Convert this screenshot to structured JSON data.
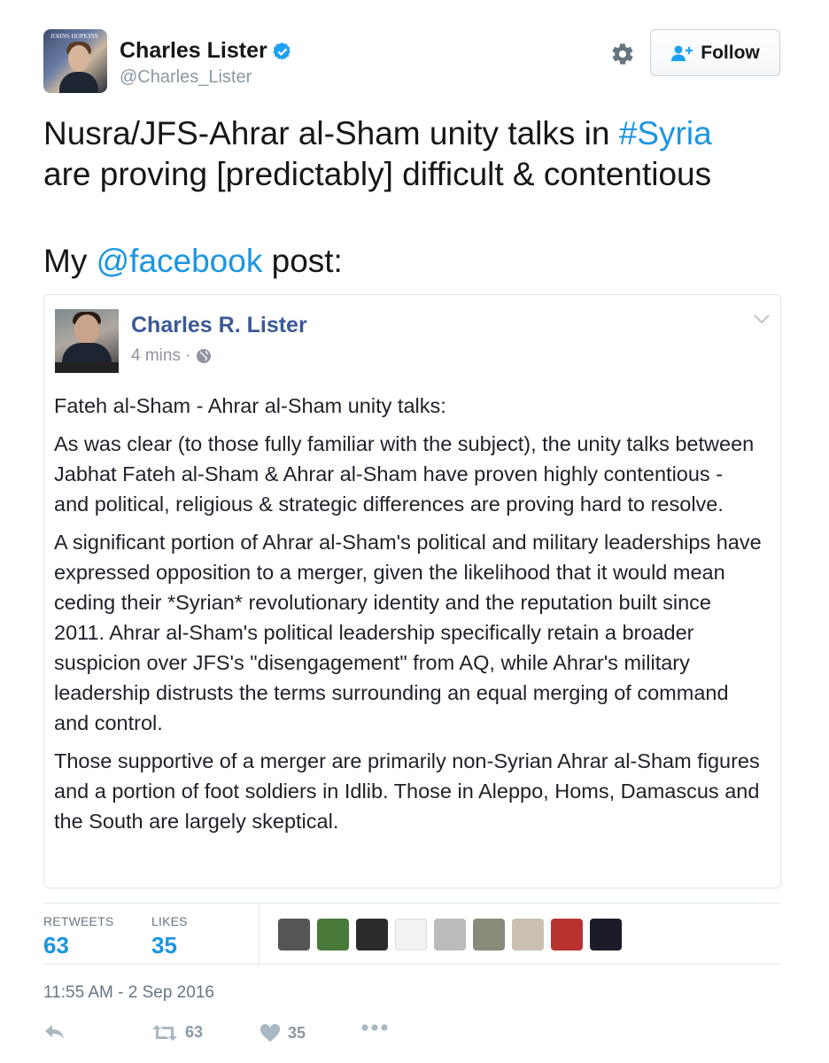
{
  "header": {
    "display_name": "Charles Lister",
    "handle": "@Charles_Lister",
    "avatar_text": "JOHNS HOPKINS",
    "follow_label": "Follow"
  },
  "tweet": {
    "line1_pre": "Nusra/JFS-Ahrar al-Sham unity talks in ",
    "hashtag": "#Syria",
    "line2": "are proving [predictably] difficult & contentious",
    "line3_pre": "My ",
    "mention": "@facebook",
    "line3_post": " post:"
  },
  "facebook_post": {
    "author": "Charles R. Lister",
    "time": "4 mins · ",
    "paragraphs": [
      "Fateh al-Sham - Ahrar al-Sham unity talks:",
      "As was clear (to those fully familiar with the subject), the unity talks between Jabhat Fateh al-Sham & Ahrar al-Sham have proven highly contentious - and political, religious & strategic differences are proving hard to resolve.",
      "A significant portion of Ahrar al-Sham's political and military leaderships have expressed opposition to a merger, given the likelihood that it would mean ceding their *Syrian* revolutionary identity and the reputation built since 2011. Ahrar al-Sham's political leadership specifically retain a broader suspicion over JFS's \"disengagement\" from AQ, while Ahrar's military leadership distrusts the terms surrounding an equal merging of command and control.",
      "Those supportive of a merger are primarily non-Syrian Ahrar al-Sham figures and a portion of foot soldiers in Idlib. Those in Aleppo, Homs, Damascus and the South are largely skeptical."
    ]
  },
  "stats": {
    "retweets_label": "RETWEETS",
    "retweets_value": "63",
    "likes_label": "LIKES",
    "likes_value": "35",
    "liker_colors": [
      "#555555",
      "#4a7a3a",
      "#2b2b2b",
      "#f2f2f2",
      "#bbbbbb",
      "#8a8a7a",
      "#c9c0b0",
      "#b8332f",
      "#1b1b2a"
    ]
  },
  "timestamp": "11:55 AM - 2 Sep 2016",
  "actions": {
    "retweet_count": "63",
    "like_count": "35"
  },
  "colors": {
    "link": "#1b95e0",
    "facebook_blue": "#3b5998",
    "verified": "#1da1f2",
    "muted": "#8899a6"
  }
}
